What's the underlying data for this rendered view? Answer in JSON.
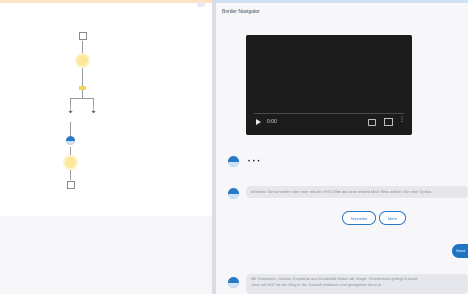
{
  "left_panel": {
    "diagram_nodes": [
      {
        "name": "start-node-icon",
        "kind": "square"
      },
      {
        "name": "message-node-icon",
        "kind": "yellow-circle"
      },
      {
        "name": "condition-node-icon",
        "kind": "small-bar"
      },
      {
        "name": "branch-left-node-icon",
        "kind": "arrow"
      },
      {
        "name": "branch-right-node-icon",
        "kind": "arrow"
      },
      {
        "name": "bot-node-icon",
        "kind": "blue-circle"
      },
      {
        "name": "message-node-2-icon",
        "kind": "yellow-circle"
      },
      {
        "name": "end-node-icon",
        "kind": "square"
      }
    ]
  },
  "chat": {
    "header": "Border Navigator",
    "video": {
      "time": "0:00"
    },
    "typing_indicator": "• • •",
    "message_1": "Möchten Sie schneller oder eher mit der HHT-Mitte als beim letzten Mal? Bitte wählen Sie eine Option.",
    "quick_replies": [
      "Schneller",
      "Mehr"
    ],
    "send_label": "Send",
    "message_2_line_1": "Mit Teamwork, Geduld, Empathie und Kreativität finden wir Wege: Gemeinsam gelingt Zukunft.",
    "message_2_line_2": "Jetzt mit HHT ist der Weg in die Zukunft einfacher und geeigneter denn je."
  },
  "colors": {
    "accent": "#2b78c8",
    "yellow_node": "#fde79a",
    "bubble_bg": "#e6e7ec"
  }
}
